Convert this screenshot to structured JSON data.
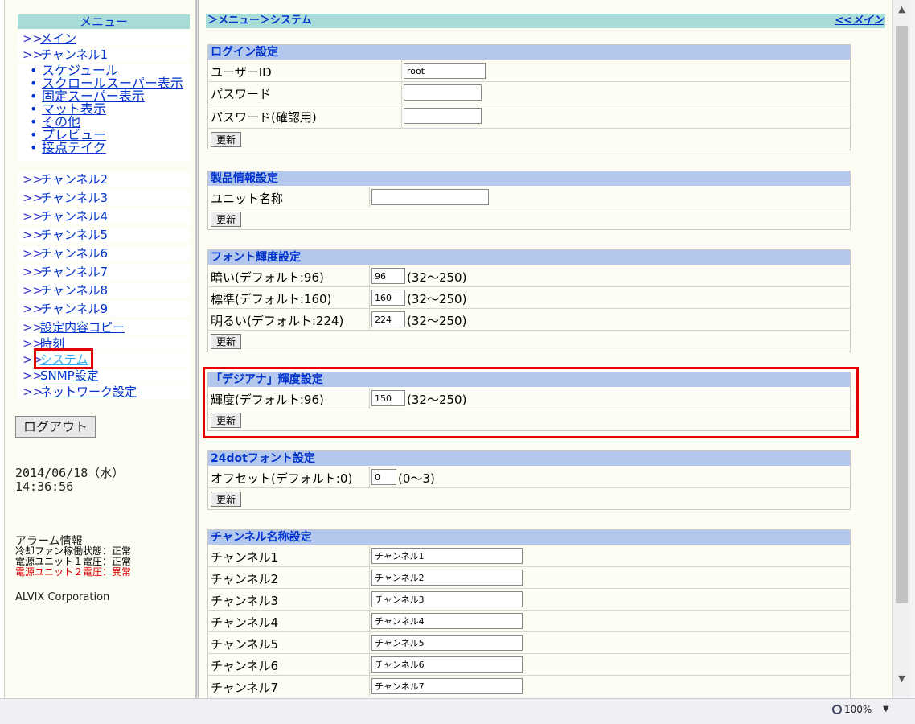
{
  "sidebar": {
    "title": "メニュー",
    "items": [
      {
        "arrow": ">>",
        "label": "メイン",
        "link": true
      },
      {
        "arrow": ">>",
        "label": "チャンネル1",
        "link": false
      }
    ],
    "sub_items": [
      "スケジュール",
      "スクロールスーパー表示",
      "固定スーパー表示",
      "マット表示",
      "その他",
      "プレビュー",
      "接点テイク"
    ],
    "channels": [
      {
        "arrow": ">>",
        "label": "チャンネル2"
      },
      {
        "arrow": ">>",
        "label": "チャンネル3"
      },
      {
        "arrow": ">>",
        "label": "チャンネル4"
      },
      {
        "arrow": ">>",
        "label": "チャンネル5"
      },
      {
        "arrow": ">>",
        "label": "チャンネル6"
      },
      {
        "arrow": ">>",
        "label": "チャンネル7"
      },
      {
        "arrow": ">>",
        "label": "チャンネル8"
      },
      {
        "arrow": ">>",
        "label": "チャンネル9"
      }
    ],
    "links": [
      {
        "arrow": ">>",
        "label": "設定内容コピー"
      },
      {
        "arrow": ">>",
        "label": "時刻"
      },
      {
        "arrow": ">>",
        "label": "システム"
      },
      {
        "arrow": ">>",
        "label": "SNMP設定"
      },
      {
        "arrow": ">>",
        "label": "ネットワーク設定"
      }
    ],
    "logout_label": "ログアウト",
    "date": "2014/06/18（水）",
    "time": "14:36:56",
    "alarm_title": "アラーム情報",
    "alarms": [
      {
        "text": "冷却ファン稼働状態：正常",
        "color": "#000000"
      },
      {
        "text": "電源ユニット１電圧：正常",
        "color": "#000000"
      },
      {
        "text": "電源ユニット２電圧：異常",
        "color": "#dd0000"
      }
    ],
    "corp": "ALVIX Corporation"
  },
  "breadcrumb": {
    "left": "＞メニュー＞システム",
    "right": "<<メイン"
  },
  "update_label": "更新",
  "login": {
    "title": "ログイン設定",
    "rows": [
      {
        "label": "ユーザーID",
        "value": ""
      },
      {
        "label": "パスワード",
        "value": ""
      },
      {
        "label": "パスワード(確認用)",
        "value": ""
      }
    ],
    "user_id": "root"
  },
  "product": {
    "title": "製品情報設定",
    "label": "ユニット名称",
    "value": ""
  },
  "font_brightness": {
    "title": "フォント輝度設定",
    "rows": [
      {
        "label": "暗い(デフォルト:96)",
        "value": "96",
        "range": "(32～250)"
      },
      {
        "label": "標準(デフォルト:160)",
        "value": "160",
        "range": "(32～250)"
      },
      {
        "label": "明るい(デフォルト:224)",
        "value": "224",
        "range": "(32～250)"
      }
    ]
  },
  "digiana": {
    "title": "「デジアナ」輝度設定",
    "label": "輝度(デフォルト:96)",
    "value": "150",
    "range": "(32～250)"
  },
  "font24": {
    "title": "24dotフォント設定",
    "label": "オフセット(デフォルト:0)",
    "value": "0",
    "range": "(0～3)"
  },
  "channel_names": {
    "title": "チャンネル名称設定",
    "rows": [
      {
        "label": "チャンネル1",
        "value": "チャンネル1"
      },
      {
        "label": "チャンネル2",
        "value": "チャンネル2"
      },
      {
        "label": "チャンネル3",
        "value": "チャンネル3"
      },
      {
        "label": "チャンネル4",
        "value": "チャンネル4"
      },
      {
        "label": "チャンネル5",
        "value": "チャンネル5"
      },
      {
        "label": "チャンネル6",
        "value": "チャンネル6"
      },
      {
        "label": "チャンネル7",
        "value": "チャンネル7"
      }
    ]
  },
  "status": {
    "zoom": "100%"
  },
  "colors": {
    "highlight": "#e00000",
    "link": "#0033cc",
    "section_header": "#b4c8ee",
    "menu_header": "#a8dcd8"
  }
}
